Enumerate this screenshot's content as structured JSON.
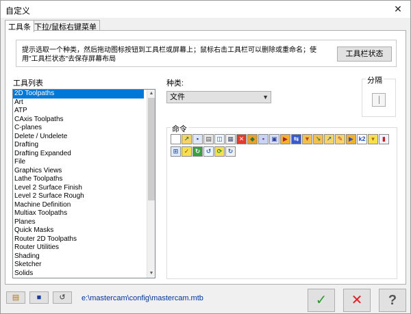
{
  "window": {
    "title": "自定义",
    "close_label": "✕"
  },
  "tabs": [
    {
      "label": "工具条",
      "active": true
    },
    {
      "label": "下拉/鼠标右键菜单",
      "active": false
    }
  ],
  "hint": {
    "text": "提示选取一个种类，然后拖动图标按钮到工具栏或屏幕上；鼠标右击工具栏可以删除或重命名；使用\"工具栏状态\"去保存屏幕布局",
    "state_button": "工具栏状态"
  },
  "toolbar_list": {
    "label": "工具列表",
    "items": [
      "2D Toolpaths",
      "Art",
      "ATP",
      "CAxis Toolpaths",
      "C-planes",
      "Delete / Undelete",
      "Drafting",
      "Drafting Expanded",
      "File",
      "Graphics Views",
      "Lathe Toolpaths",
      "Level 2 Surface Finish",
      "Level 2 Surface Rough",
      "Machine Definition",
      "Multiax Toolpaths",
      "Planes",
      "Quick Masks",
      "Router 2D Toolpaths",
      "Router Utilities",
      "Shading",
      "Sketcher",
      "Solids"
    ],
    "selected_index": 0
  },
  "category": {
    "label": "种类:",
    "value": "文件"
  },
  "separator": {
    "label": "分隔"
  },
  "commands": {
    "label": "命令",
    "icons": [
      {
        "name": "new-file-icon",
        "glyph": "",
        "bg": "#ffffff",
        "fg": "#333333"
      },
      {
        "name": "open-file-icon",
        "glyph": "↗",
        "bg": "#f5d36b",
        "fg": "#2a7a2a"
      },
      {
        "name": "save-icon",
        "glyph": "▪",
        "bg": "#dfe6f5",
        "fg": "#1c3c9c"
      },
      {
        "name": "print-icon",
        "glyph": "▤",
        "bg": "#e8e8e8",
        "fg": "#555555"
      },
      {
        "name": "print-preview-icon",
        "glyph": "◫",
        "bg": "#eef6ff",
        "fg": "#3355aa"
      },
      {
        "name": "page-setup-icon",
        "glyph": "▦",
        "bg": "#f0f0f0",
        "fg": "#445577"
      },
      {
        "name": "delete-file-icon",
        "glyph": "✕",
        "bg": "#e23c2c",
        "fg": "#ffffff"
      },
      {
        "name": "merge-icon",
        "glyph": "◆",
        "bg": "#e8a030",
        "fg": "#2a7a2a"
      },
      {
        "name": "save-as-icon",
        "glyph": "▪",
        "bg": "#c8d4f0",
        "fg": "#6a2aa0"
      },
      {
        "name": "save-some-icon",
        "glyph": "▣",
        "bg": "#d8e0f8",
        "fg": "#2a3c9c"
      },
      {
        "name": "export-icon",
        "glyph": "▶",
        "bg": "#f2b030",
        "fg": "#b02020"
      },
      {
        "name": "convert-icon",
        "glyph": "⇆",
        "bg": "#3a5ad0",
        "fg": "#ffffff"
      },
      {
        "name": "import-folder-icon",
        "glyph": "▼",
        "bg": "#f2c050",
        "fg": "#c04020"
      },
      {
        "name": "browse-icon",
        "glyph": "↘",
        "bg": "#f2c050",
        "fg": "#2a8a2a"
      },
      {
        "name": "open-external-icon",
        "glyph": "↗",
        "bg": "#f5d36b",
        "fg": "#2a6aa0"
      },
      {
        "name": "edit-file-icon",
        "glyph": "✎",
        "bg": "#f5d36b",
        "fg": "#c03030"
      },
      {
        "name": "recent-files-icon",
        "glyph": "▶",
        "bg": "#f2b030",
        "fg": "#3050c0"
      },
      {
        "name": "version-icon",
        "glyph": "k2",
        "bg": "#ffffff",
        "fg": "#2050c0"
      },
      {
        "name": "trophy-icon",
        "glyph": "▾",
        "bg": "#f5e050",
        "fg": "#b06010"
      },
      {
        "name": "exit-icon",
        "glyph": "▮",
        "bg": "#f0f0ff",
        "fg": "#c02020"
      },
      {
        "name": "properties-icon",
        "glyph": "⊞",
        "bg": "#dfe9ff",
        "fg": "#3355aa"
      },
      {
        "name": "checkmark-icon",
        "glyph": "✓",
        "bg": "#f5e050",
        "fg": "#d02020"
      },
      {
        "name": "refresh-green-icon",
        "glyph": "↻",
        "bg": "#3aa040",
        "fg": "#ffffff"
      },
      {
        "name": "rotate-icon",
        "glyph": "↺",
        "bg": "#eef6ff",
        "fg": "#2a5ac0"
      },
      {
        "name": "regen-icon",
        "glyph": "⟳",
        "bg": "#f5e050",
        "fg": "#2a8a2a"
      },
      {
        "name": "cycle-icon",
        "glyph": "↻",
        "bg": "#f0f0f0",
        "fg": "#2a5ac0"
      }
    ]
  },
  "bottom": {
    "open_glyph": "▤",
    "save_glyph": "■",
    "undo_glyph": "↺",
    "path": "e:\\mastercam\\config\\mastercam.mtb",
    "ok_glyph": "✓",
    "cancel_glyph": "✕",
    "help_glyph": "?"
  },
  "colors": {
    "selection": "#0078d7",
    "path_text": "#003399",
    "ok": "#2a9a2a",
    "cancel": "#e02020"
  }
}
